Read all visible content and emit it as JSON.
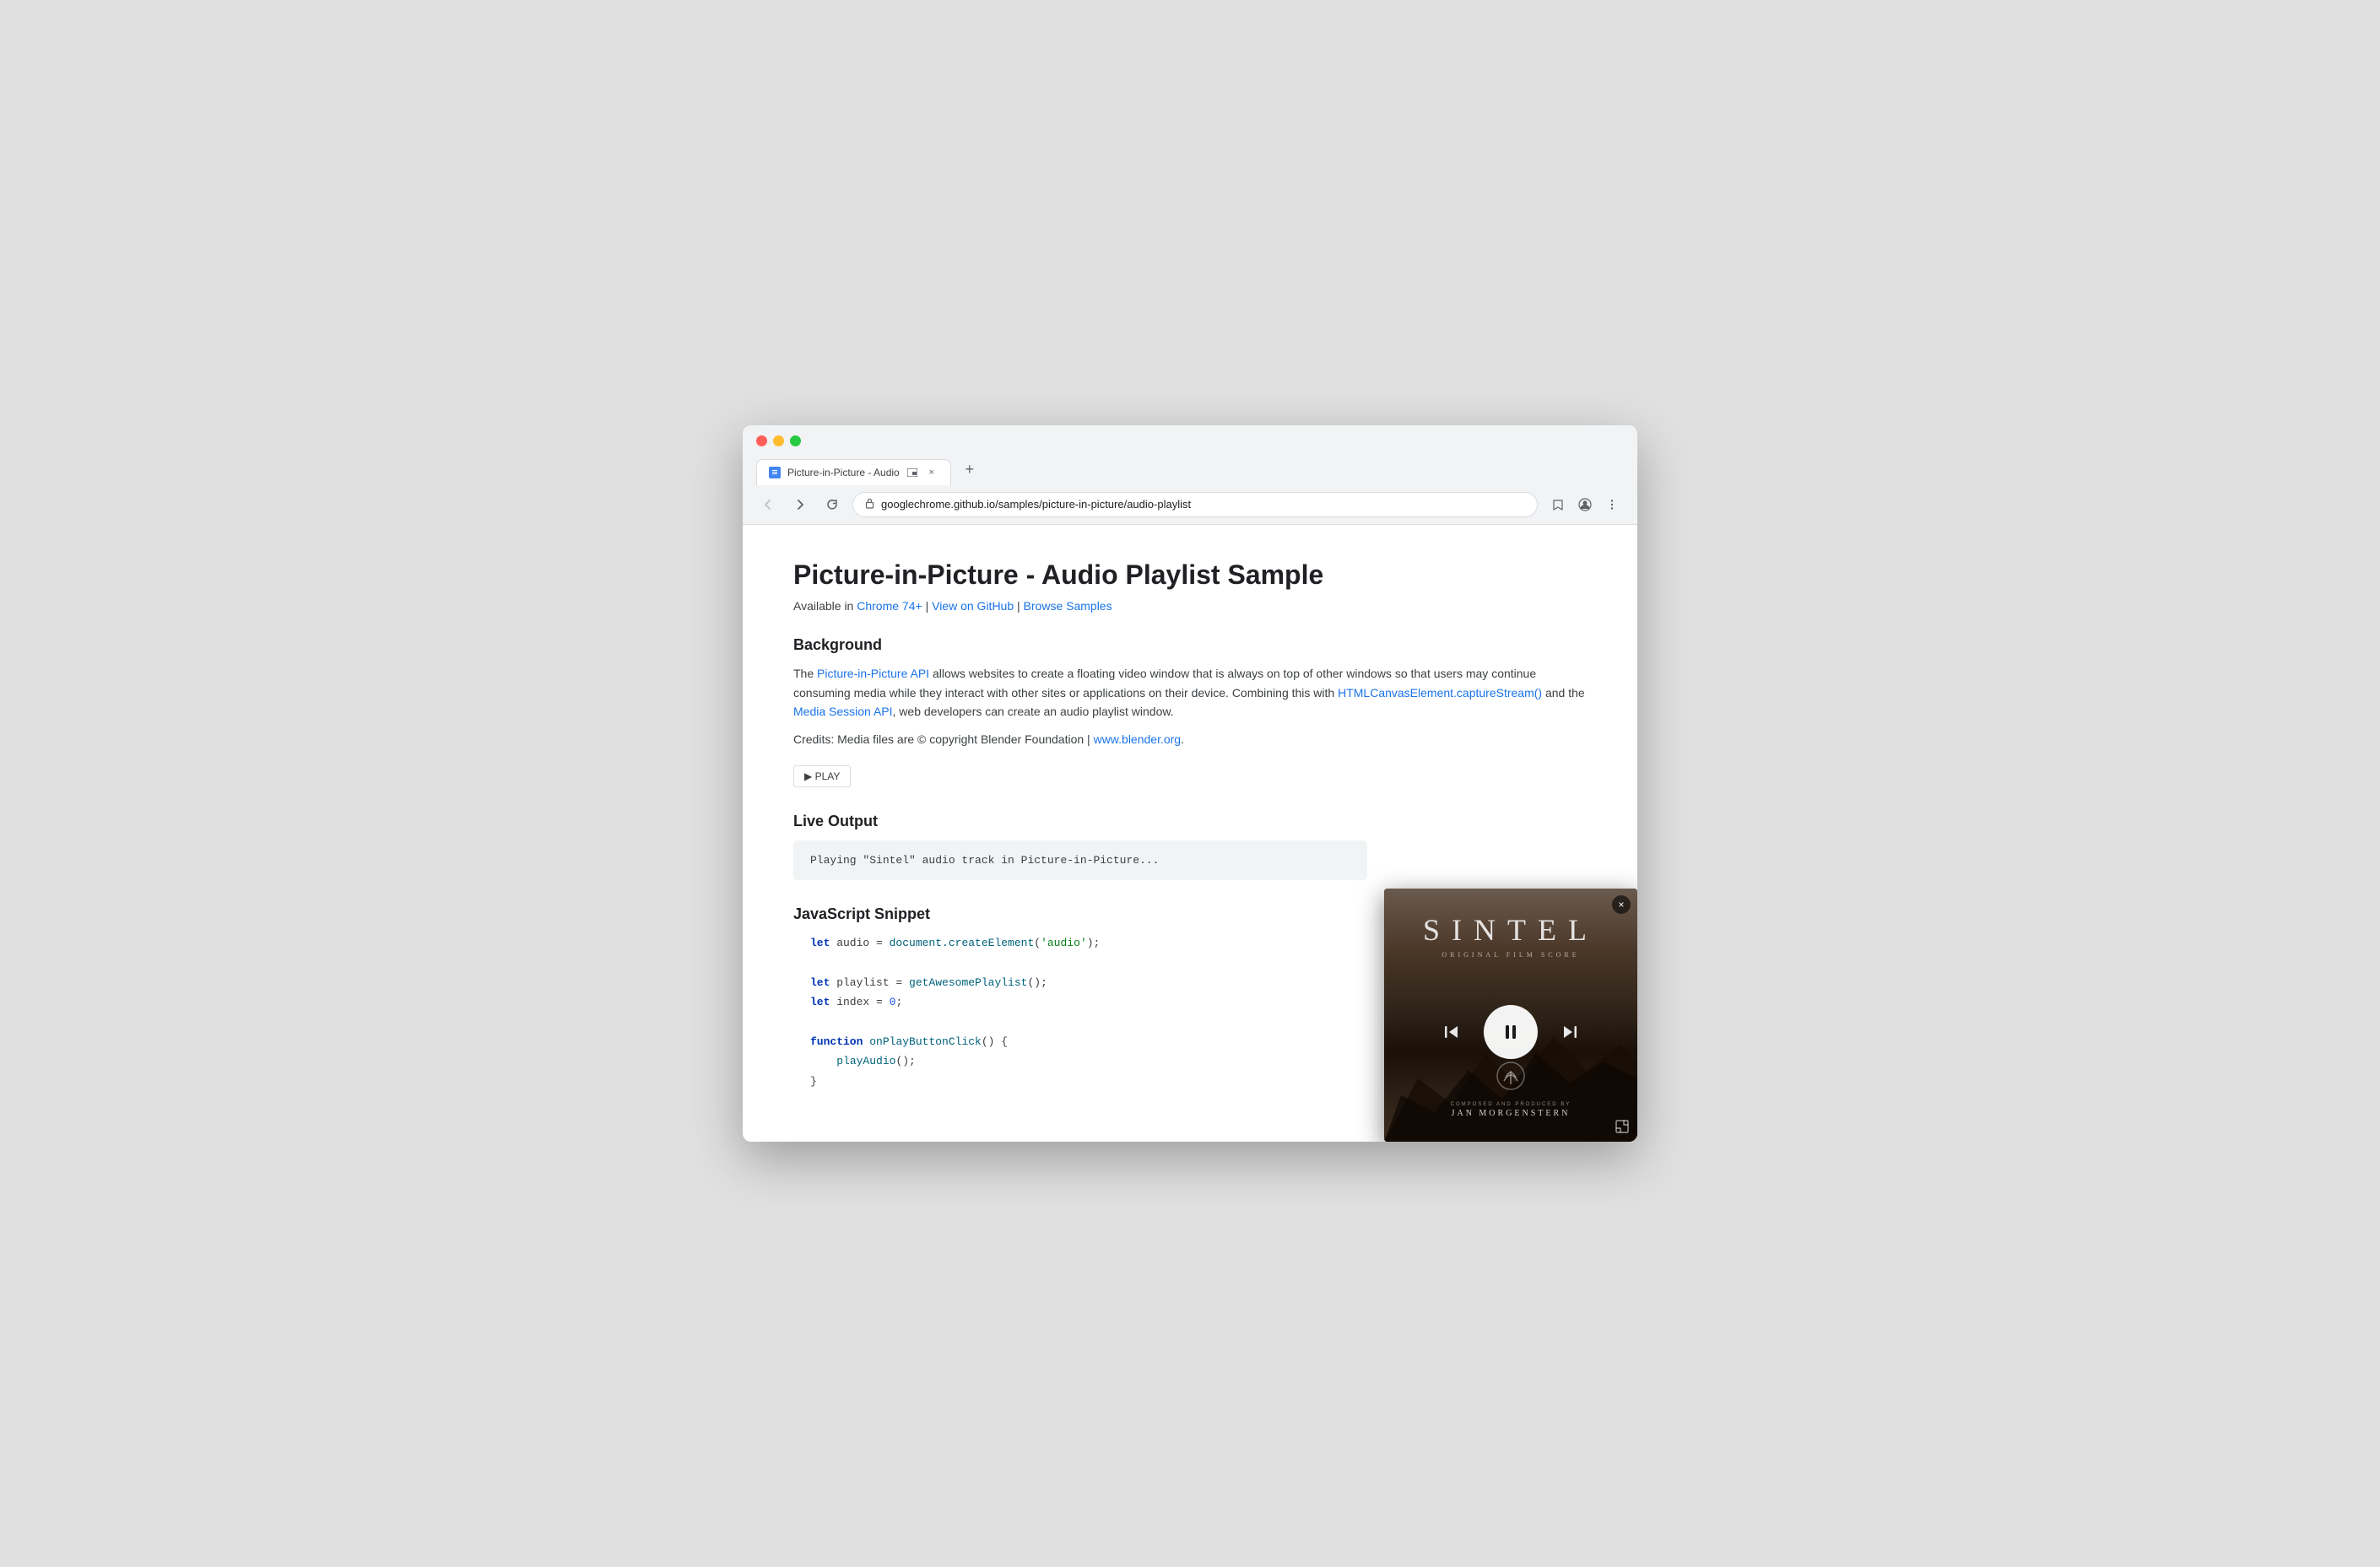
{
  "browser": {
    "title": "Picture-in-Picture - Audio",
    "tab_favicon": "🎵",
    "tab_close": "×",
    "new_tab": "+",
    "url": "googlechrome.github.io/samples/picture-in-picture/audio-playlist",
    "nav": {
      "back": "←",
      "forward": "→",
      "reload": "↻"
    }
  },
  "page": {
    "title": "Picture-in-Picture - Audio Playlist Sample",
    "availability": {
      "prefix": "Available in",
      "chrome_link_text": "Chrome 74+",
      "github_link_text": "View on GitHub",
      "samples_link_text": "Browse Samples",
      "separator": "|"
    },
    "background": {
      "heading": "Background",
      "para1_prefix": "The ",
      "pip_link": "Picture-in-Picture API",
      "para1_suffix": " allows websites to create a floating video window that is always on top of other windows so that users may continue consuming media while they interact with other sites or applications on their device. Combining this with ",
      "canvas_link": "HTMLCanvasElement.captureStream()",
      "para1_mid": " and the ",
      "media_link": "Media Session API",
      "para1_end": ", web developers can create an audio playlist window.",
      "credits": "Credits: Media files are © copyright Blender Foundation | ",
      "credits_link": "www.blender.org",
      "credits_end": "."
    },
    "play_button": "▶ PLAY",
    "live_output": {
      "heading": "Live Output",
      "text": "Playing \"Sintel\" audio track in Picture-in-Picture..."
    },
    "snippet": {
      "heading": "JavaScript Snippet",
      "lines": [
        {
          "type": "code",
          "parts": [
            {
              "t": "kw",
              "v": "let"
            },
            {
              "t": "plain",
              "v": " audio = "
            },
            {
              "t": "fn",
              "v": "document.createElement"
            },
            {
              "t": "plain",
              "v": "("
            },
            {
              "t": "str",
              "v": "'audio'"
            },
            {
              "t": "plain",
              "v": ");"
            }
          ]
        },
        {
          "type": "blank"
        },
        {
          "type": "code",
          "parts": [
            {
              "t": "kw",
              "v": "let"
            },
            {
              "t": "plain",
              "v": " playlist = "
            },
            {
              "t": "fn",
              "v": "getAwesomePlaylist"
            },
            {
              "t": "plain",
              "v": "();"
            }
          ]
        },
        {
          "type": "code",
          "parts": [
            {
              "t": "kw",
              "v": "let"
            },
            {
              "t": "plain",
              "v": " index = "
            },
            {
              "t": "num",
              "v": "0"
            },
            {
              "t": "plain",
              "v": ";"
            }
          ]
        },
        {
          "type": "blank"
        },
        {
          "type": "code",
          "parts": [
            {
              "t": "kw",
              "v": "function"
            },
            {
              "t": "plain",
              "v": " "
            },
            {
              "t": "fn",
              "v": "onPlayButtonClick"
            },
            {
              "t": "plain",
              "v": "() {"
            }
          ]
        },
        {
          "type": "code",
          "parts": [
            {
              "t": "plain",
              "v": "    "
            },
            {
              "t": "fn",
              "v": "playAudio"
            },
            {
              "t": "plain",
              "v": "();"
            }
          ]
        },
        {
          "type": "code",
          "parts": [
            {
              "t": "plain",
              "v": "}"
            }
          ]
        }
      ]
    }
  },
  "pip": {
    "sintel_title": "SINTEL",
    "sintel_subtitle": "ORIGINAL FILM SCORE",
    "close_btn": "×",
    "expand_btn": "⛶",
    "prev_btn": "⏮",
    "pause_btn": "⏸",
    "next_btn": "⏭",
    "credits_label": "Composed and Produced by",
    "credits_name": "JAN MORGENSTERN"
  }
}
